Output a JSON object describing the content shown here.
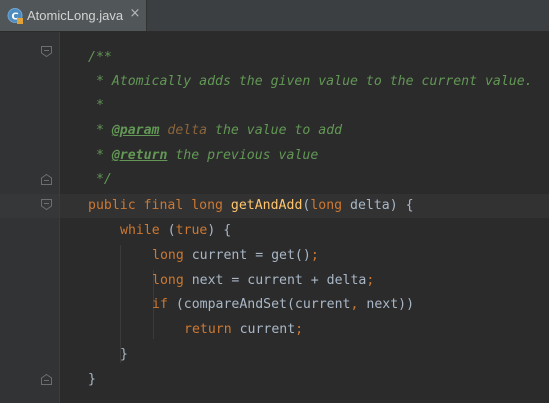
{
  "tab": {
    "label": "AtomicLong.java",
    "close": "×",
    "icon": "java-class-c-icon"
  },
  "colors": {
    "background": "#2b2b2b",
    "keyword": "#cc7832",
    "method": "#ffc66d",
    "doc_comment": "#629755",
    "param_name": "#8a653b",
    "plain": "#a9b7c6"
  },
  "code": {
    "l1": {
      "t": "/**"
    },
    "l2": {
      "t": " * Atomically adds the given value to the current value."
    },
    "l3": {
      "t": " *"
    },
    "l4": {
      "pre": " * ",
      "tag": "@param",
      "name": " delta",
      "rest": " the value to add"
    },
    "l5": {
      "pre": " * ",
      "tag": "@return",
      "rest": " the previous value"
    },
    "l6": {
      "t": " */"
    },
    "l7": {
      "kw1": "public final long ",
      "mth": "getAndAdd",
      "p1": "(",
      "kw2": "long",
      "p2": " delta) {"
    },
    "l8": {
      "kw1": "while",
      "p1": " (",
      "kw2": "true",
      "p2": ") {"
    },
    "l9": {
      "kw1": "long",
      "p1": " current = get()",
      "kw2": ";"
    },
    "l10": {
      "kw1": "long",
      "p1": " next = current + delta",
      "kw2": ";"
    },
    "l11": {
      "kw1": "if",
      "p1": " (compareAndSet(current",
      "kw2": ",",
      "p2": " next))"
    },
    "l12": {
      "kw1": "return",
      "p1": " current",
      "kw2": ";"
    },
    "l13": {
      "t": "}"
    },
    "l14": {
      "t": "}"
    }
  }
}
